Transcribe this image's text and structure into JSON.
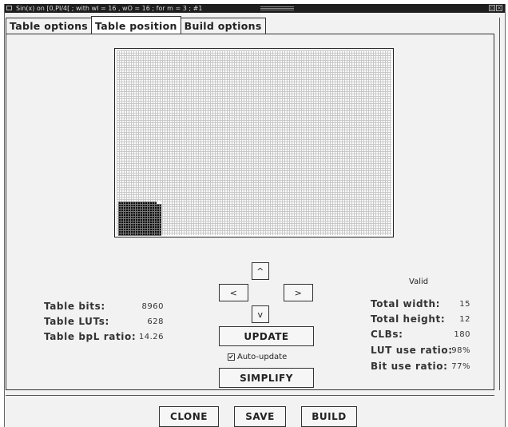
{
  "window": {
    "title": "Sin(x)      on [0,PI/4[ ;  with wI = 16 , wO = 16 ;  for m = 3 ;  #1"
  },
  "tabs": [
    {
      "label": "Table options",
      "active": false
    },
    {
      "label": "Table position",
      "active": true
    },
    {
      "label": "Build options",
      "active": false
    }
  ],
  "stats_left": [
    {
      "label": "Table bits:",
      "value": "8960"
    },
    {
      "label": "Table LUTs:",
      "value": "628"
    },
    {
      "label": "Table bpL ratio:",
      "value": "14.26"
    }
  ],
  "status": "Valid",
  "stats_right": [
    {
      "label": "Total width:",
      "value": "15"
    },
    {
      "label": "Total height:",
      "value": "12"
    },
    {
      "label": "CLBs:",
      "value": "180"
    },
    {
      "label": "LUT use ratio:",
      "value": "98%"
    },
    {
      "label": "Bit use ratio:",
      "value": "77%"
    }
  ],
  "nav": {
    "up": "^",
    "left": "<",
    "right": ">",
    "down": "v"
  },
  "buttons": {
    "update": "UPDATE",
    "simplify": "SIMPLIFY",
    "clone": "CLONE",
    "save": "SAVE",
    "build": "BUILD"
  },
  "auto_update": {
    "label": "Auto-update",
    "checked": true
  }
}
